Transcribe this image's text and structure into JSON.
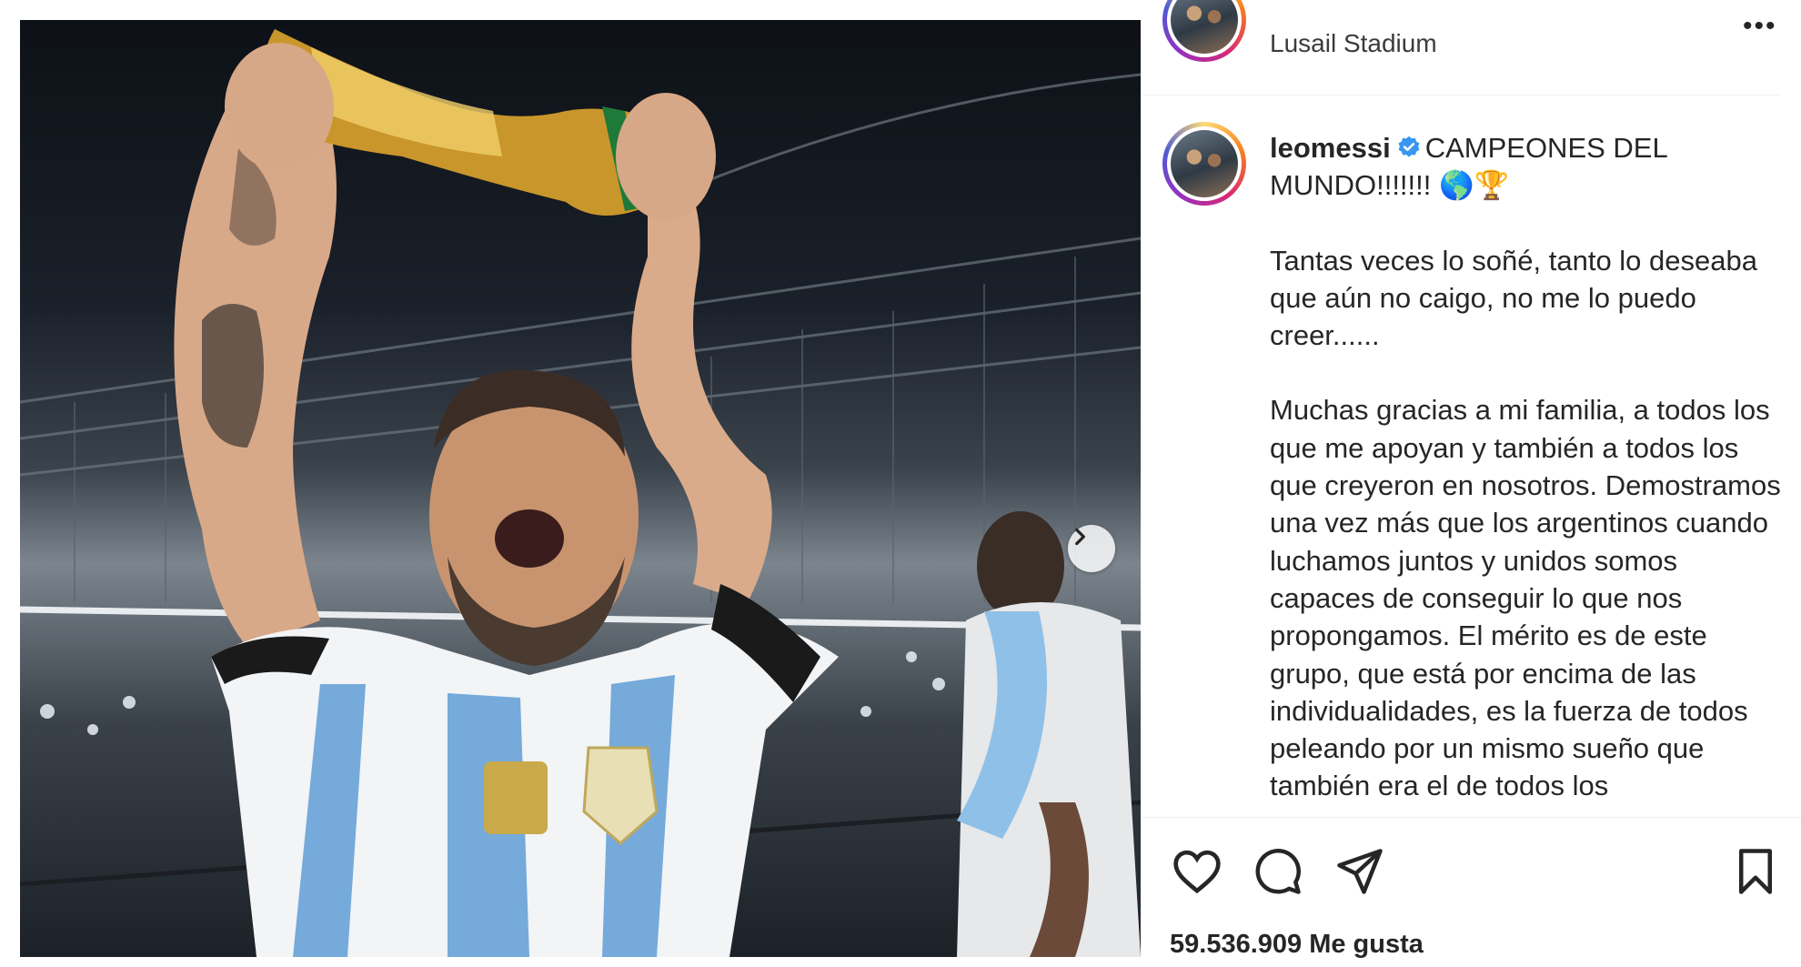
{
  "post": {
    "location": "Lusail Stadium",
    "username": "leomessi",
    "caption_first": "CAMPEONES DEL MUNDO!!!!!!! 🌎🏆",
    "caption_paragraphs": [
      "Tantas veces lo soñé, tanto lo deseaba que aún no caigo, no me lo puedo creer......",
      "Muchas gracias a mi familia, a todos los que me apoyan y también a todos los que creyeron en nosotros. Demostramos una vez más que los argentinos cuando luchamos juntos y unidos somos capaces de conseguir lo que nos propongamos. El mérito es de este grupo, que está por encima de las individualidades, es la fuerza de todos peleando por un mismo sueño que también era el de todos los"
    ],
    "likes": "59.536.909 Me gusta"
  },
  "icons": {
    "more": "more-options-icon",
    "verified": "verified-badge-icon",
    "like": "heart-icon",
    "comment": "comment-icon",
    "share": "send-icon",
    "save": "bookmark-icon",
    "next": "chevron-right-icon"
  },
  "colors": {
    "verified": "#3897f0",
    "text": "#262626",
    "jersey_blue": "#75aadb"
  }
}
